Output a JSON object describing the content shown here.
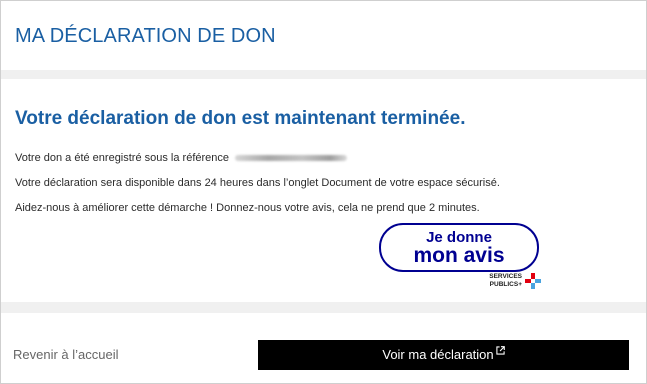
{
  "header": {
    "title": "MA DÉCLARATION DE DON"
  },
  "confirmation": {
    "title": "Votre déclaration de don est maintenant terminée.",
    "reference_label": "Votre don a été enregistré sous la référence",
    "availability_text": "Votre déclaration sera disponible dans 24 heures dans l’onglet Document de votre espace sécurisé.",
    "feedback_text": "Aidez-nous à améliorer cette démarche ! Donnez-nous votre avis, cela ne prend que 2 minutes."
  },
  "feedback_badge": {
    "line1": "Je donne",
    "line2": "mon avis",
    "color": "#000091"
  },
  "services_publics_logo": {
    "line1": "SERVICES",
    "line2": "PUBLICS+",
    "icon": "plus-cross-icon"
  },
  "footer": {
    "back_link": "Revenir à l’accueil",
    "primary_button": "Voir ma déclaration",
    "primary_button_icon": "external-link-icon"
  },
  "colors": {
    "accent": "#1a5fa3",
    "button_bg": "#000000",
    "button_text": "#ffffff",
    "page_bg": "#f0f0f0"
  }
}
